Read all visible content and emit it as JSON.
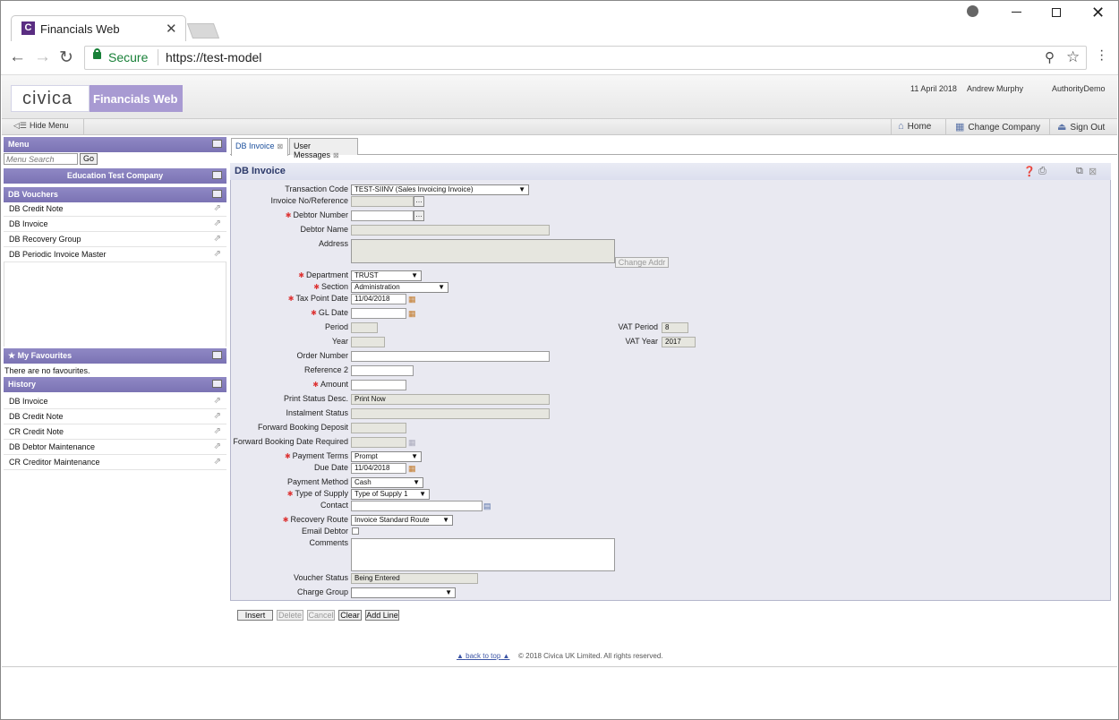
{
  "browser": {
    "tab_title": "Financials Web",
    "favicon_letter": "C",
    "secure_label": "Secure",
    "url": "https://test-model"
  },
  "header": {
    "logo": "civica",
    "product": "Financials Web",
    "date": "11 April 2018",
    "user": "Andrew Murphy",
    "authority": "AuthorityDemo"
  },
  "topbar": {
    "hide_menu": "Hide Menu",
    "home": "Home",
    "change_company": "Change Company",
    "sign_out": "Sign Out"
  },
  "menu": {
    "title": "Menu",
    "search_placeholder": "Menu Search",
    "go": "Go",
    "company": "Education Test Company",
    "section_title": "DB Vouchers",
    "items": [
      {
        "label": "DB Credit Note"
      },
      {
        "label": "DB Invoice"
      },
      {
        "label": "DB Recovery Group"
      },
      {
        "label": "DB Periodic Invoice Master"
      }
    ]
  },
  "favourites": {
    "title": "My Favourites",
    "empty": "There are no favourites."
  },
  "history": {
    "title": "History",
    "items": [
      {
        "label": "DB Invoice"
      },
      {
        "label": "DB Credit Note"
      },
      {
        "label": "CR Credit Note"
      },
      {
        "label": "DB Debtor Maintenance"
      },
      {
        "label": "CR Creditor Maintenance"
      }
    ]
  },
  "tabs": [
    {
      "label": "DB Invoice",
      "active": true
    },
    {
      "label": "User Messages",
      "active": false
    }
  ],
  "form": {
    "title": "DB Invoice",
    "labels": {
      "transaction_code": "Transaction Code",
      "invoice_ref": "Invoice No/Reference",
      "debtor_number": "Debtor Number",
      "debtor_name": "Debtor Name",
      "address": "Address",
      "department": "Department",
      "section": "Section",
      "tax_point_date": "Tax Point Date",
      "gl_date": "GL Date",
      "period": "Period",
      "year": "Year",
      "vat_period": "VAT Period",
      "vat_year": "VAT Year",
      "order_number": "Order Number",
      "reference_2": "Reference 2",
      "amount": "Amount",
      "print_status": "Print Status Desc.",
      "instalment_status": "Instalment Status",
      "fwd_deposit": "Forward Booking Deposit",
      "fwd_date": "Forward Booking Date Required",
      "payment_terms": "Payment Terms",
      "due_date": "Due Date",
      "payment_method": "Payment Method",
      "type_of_supply": "Type of Supply",
      "contact": "Contact",
      "recovery_route": "Recovery Route",
      "email_debtor": "Email Debtor",
      "comments": "Comments",
      "voucher_status": "Voucher Status",
      "charge_group": "Charge Group"
    },
    "values": {
      "transaction_code": "TEST-SIINV (Sales Invoicing Invoice)",
      "department": "TRUST",
      "section": "Administration",
      "tax_point_date": "11/04/2018",
      "vat_period": "8",
      "vat_year": "2017",
      "print_status": "Print Now",
      "payment_terms": "Prompt",
      "due_date": "11/04/2018",
      "payment_method": "Cash",
      "type_of_supply": "Type of Supply 1",
      "recovery_route": "Invoice Standard Route",
      "voucher_status": "Being Entered"
    },
    "change_addr": "Change Addr",
    "buttons": {
      "insert": "Insert",
      "delete": "Delete",
      "cancel": "Cancel",
      "clear": "Clear",
      "add_line": "Add Line"
    }
  },
  "footer": {
    "back_to_top": "back to top",
    "copyright": "© 2018 Civica UK Limited. All rights reserved."
  }
}
